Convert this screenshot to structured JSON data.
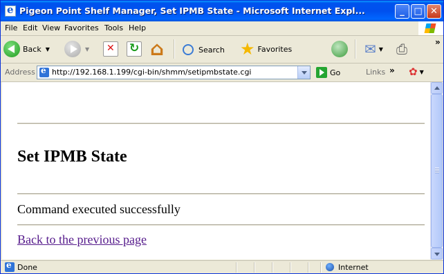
{
  "window": {
    "title": "Pigeon Point Shelf Manager, Set IPMB State - Microsoft Internet Expl...",
    "controls": {
      "minimize": "_",
      "maximize": "□",
      "close": "✕"
    }
  },
  "menu": {
    "items": [
      "File",
      "Edit",
      "View",
      "Favorites",
      "Tools",
      "Help"
    ]
  },
  "toolbar": {
    "back_label": "Back",
    "search_label": "Search",
    "favorites_label": "Favorites",
    "overflow": "»"
  },
  "address_bar": {
    "label": "Address",
    "url": "http://192.168.1.199/cgi-bin/shmm/setipmbstate.cgi",
    "go_label": "Go",
    "links_label": "Links",
    "overflow": "»"
  },
  "page": {
    "heading": "Set IPMB State",
    "message": "Command executed successfully",
    "back_link": "Back to the previous page"
  },
  "status_bar": {
    "status": "Done",
    "zone": "Internet"
  },
  "colors": {
    "titlebar": "#0055ee",
    "link_visited": "#551a8b",
    "chrome": "#ece9d8"
  }
}
